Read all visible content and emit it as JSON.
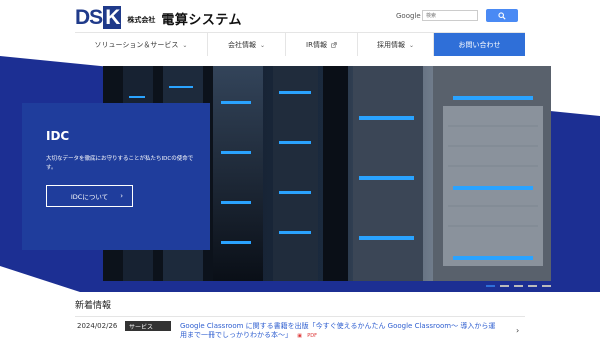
{
  "header": {
    "logo_mark": "DS",
    "logo_mark_k": "K",
    "logo_small": "株式会社",
    "logo_company": "電算システム",
    "search": {
      "google_label": "Google",
      "placeholder": "検索"
    }
  },
  "nav": {
    "items": [
      {
        "label": "ソリューション＆サービス",
        "indicator": "chevron-down-icon"
      },
      {
        "label": "会社情報",
        "indicator": "chevron-down-icon"
      },
      {
        "label": "IR情報",
        "indicator": "external-link-icon"
      },
      {
        "label": "採用情報",
        "indicator": "chevron-down-icon"
      }
    ],
    "contact_label": "お問い合わせ"
  },
  "hero": {
    "title": "IDC",
    "text": "大切なデータを徹底にお守りすることが私たちIDCの使命です。",
    "button_label": "IDCについて",
    "slide_count": 5,
    "active_slide": 1
  },
  "news": {
    "heading": "新着情報",
    "items": [
      {
        "date": "2024/02/26",
        "category": "サービス",
        "text": "Google Classroom に関する書籍を出版「今すぐ使えるかんたん Google Classroom〜 導入から運用まで一冊でしっかりわかる本〜」",
        "pdf_label": "PDF"
      }
    ]
  },
  "colors": {
    "brand": "#1f3a8a",
    "accent": "#2f6fd8",
    "hero_blue": "#1c2f93"
  }
}
